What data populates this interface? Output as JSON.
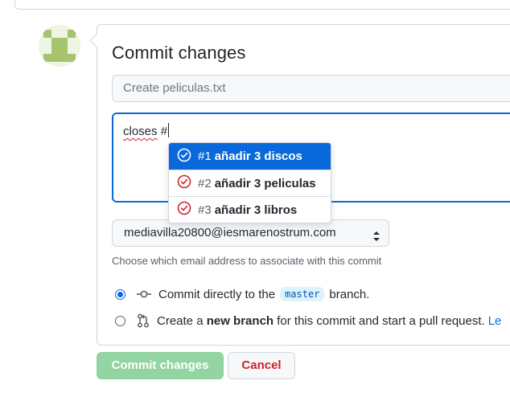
{
  "page": {
    "title": "Commit changes",
    "avatar_icon": "identicon-avatar"
  },
  "commit_form": {
    "summary_placeholder": "Create peliculas.txt",
    "description_word": "closes",
    "description_rest": " #",
    "email": {
      "selected": "mediavilla20800@iesmarenostrum.com",
      "note": "Choose which email address to associate with this commit"
    },
    "option_direct": {
      "prefix": "Commit directly to the",
      "branch": "master",
      "suffix": "branch.",
      "selected": true,
      "icon": "git-commit-icon"
    },
    "option_new_branch": {
      "prefix": "Create a",
      "bold": "new branch",
      "suffix": "for this commit and start a pull request.",
      "link": "Le",
      "selected": false,
      "icon": "git-pull-request-icon"
    },
    "commit_button": "Commit changes",
    "cancel_button": "Cancel"
  },
  "suggestions": [
    {
      "number": "#1",
      "title": "añadir 3 discos",
      "active": true,
      "icon": "issue-opened-icon"
    },
    {
      "number": "#2",
      "title": "añadir 3 peliculas",
      "active": false,
      "icon": "issue-opened-icon"
    },
    {
      "number": "#3",
      "title": "añadir 3 libros",
      "active": false,
      "icon": "issue-opened-icon"
    }
  ],
  "colors": {
    "accent": "#0969da",
    "issue_open": "#cf222e",
    "commit_disabled": "#94d3a2",
    "cancel_text": "#cf222e"
  }
}
